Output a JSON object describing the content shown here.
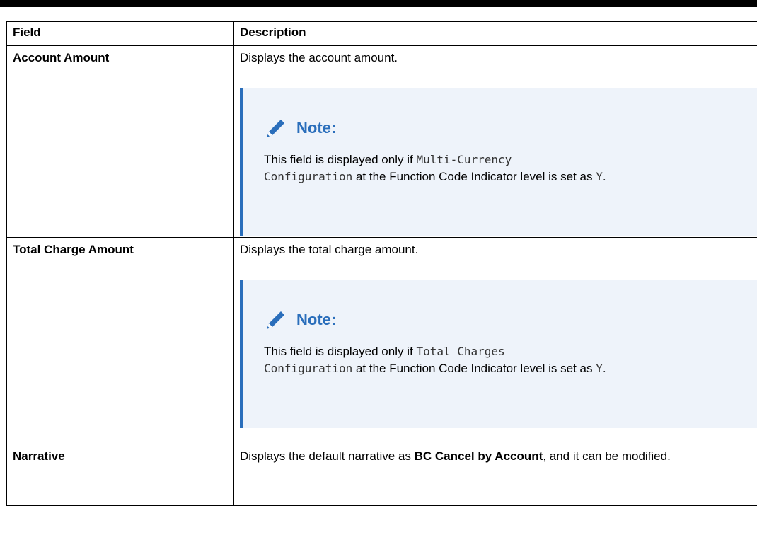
{
  "table": {
    "headers": {
      "field": "Field",
      "description": "Description"
    },
    "rows": [
      {
        "field": "Account Amount",
        "description": "Displays the account amount.",
        "note": {
          "title": "Note:",
          "text_before": "This field is displayed only if ",
          "code1": "Multi-Currency",
          "code2": "Configuration",
          "text_middle": " at the Function Code Indicator level is set as ",
          "code3": "Y",
          "text_after": "."
        }
      },
      {
        "field": "Total Charge Amount",
        "description": "Displays the total charge amount.",
        "note": {
          "title": "Note:",
          "text_before": "This field is displayed only if ",
          "code1": "Total Charges",
          "code2": "Configuration",
          "text_middle": " at the Function Code Indicator level is set as ",
          "code3": "Y",
          "text_after": "."
        }
      },
      {
        "field": "Narrative",
        "description_before": "Displays the default narrative as ",
        "description_bold": "BC Cancel by Account",
        "description_after": ", and it can be modified."
      }
    ]
  },
  "colors": {
    "note_accent": "#2a6ebb",
    "note_background": "#eef3fa"
  },
  "icons": {
    "note_icon": "pencil-icon"
  }
}
